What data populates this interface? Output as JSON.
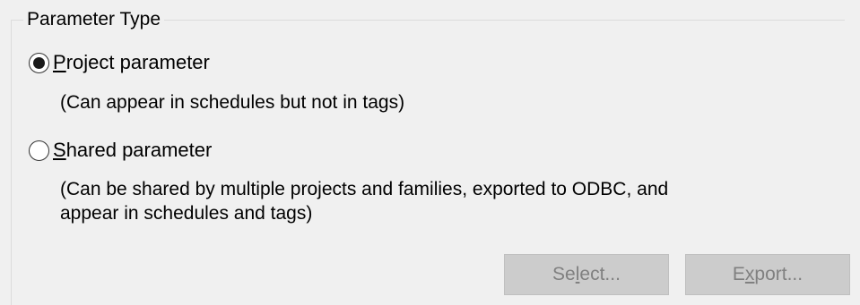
{
  "group": {
    "title": "Parameter Type"
  },
  "options": {
    "project": {
      "label": "Project parameter",
      "mnemonic": "P",
      "rest": "roject parameter",
      "checked": true,
      "description": "(Can appear in schedules but not in tags)"
    },
    "shared": {
      "label": "Shared parameter",
      "mnemonic": "S",
      "rest": "hared parameter",
      "checked": false,
      "description_line1": "(Can be shared by multiple projects and families, exported to ODBC, and",
      "description_line2": "appear in schedules and tags)"
    }
  },
  "buttons": {
    "select": {
      "pre": "Se",
      "mnemonic": "l",
      "post": "ect...",
      "label": "Select...",
      "enabled": false
    },
    "export": {
      "pre": "E",
      "mnemonic": "x",
      "post": "port...",
      "label": "Export...",
      "enabled": false
    }
  },
  "colors": {
    "background": "#f0f0f0",
    "disabled_button_bg": "#cccccc",
    "disabled_text": "#808080"
  }
}
